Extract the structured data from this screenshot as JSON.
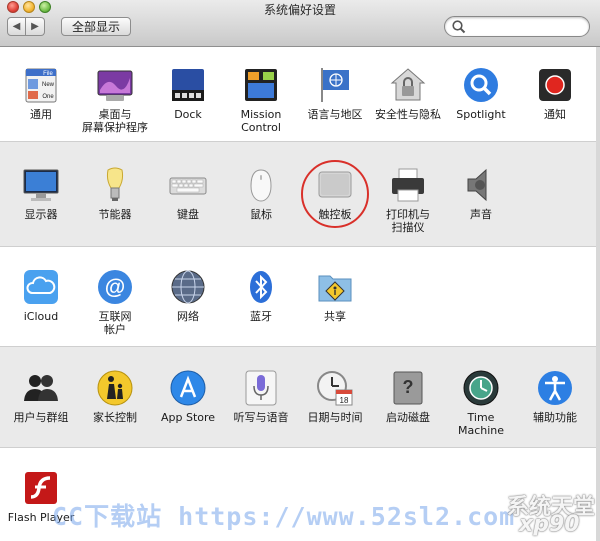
{
  "window": {
    "title": "系统偏好设置"
  },
  "toolbar": {
    "back": "◀",
    "forward": "▶",
    "show_all": "全部显示",
    "search_placeholder": "",
    "search_value": ""
  },
  "sections": [
    {
      "panes": [
        {
          "label": "通用",
          "icon": "general-icon"
        },
        {
          "label": "桌面与\n屏幕保护程序",
          "icon": "desktop-screensaver-icon"
        },
        {
          "label": "Dock",
          "icon": "dock-icon"
        },
        {
          "label": "Mission\nControl",
          "icon": "mission-control-icon"
        },
        {
          "label": "语言与地区",
          "icon": "language-region-icon"
        },
        {
          "label": "安全性与隐私",
          "icon": "security-privacy-icon"
        },
        {
          "label": "Spotlight",
          "icon": "spotlight-icon"
        },
        {
          "label": "通知",
          "icon": "notifications-icon"
        }
      ]
    },
    {
      "panes": [
        {
          "label": "显示器",
          "icon": "displays-icon"
        },
        {
          "label": "节能器",
          "icon": "energy-saver-icon"
        },
        {
          "label": "键盘",
          "icon": "keyboard-icon"
        },
        {
          "label": "鼠标",
          "icon": "mouse-icon"
        },
        {
          "label": "触控板",
          "icon": "trackpad-icon"
        },
        {
          "label": "打印机与\n扫描仪",
          "icon": "printers-scanners-icon"
        },
        {
          "label": "声音",
          "icon": "sound-icon"
        }
      ]
    },
    {
      "panes": [
        {
          "label": "iCloud",
          "icon": "icloud-icon"
        },
        {
          "label": "互联网\n帐户",
          "icon": "internet-accounts-icon"
        },
        {
          "label": "网络",
          "icon": "network-icon"
        },
        {
          "label": "蓝牙",
          "icon": "bluetooth-icon"
        },
        {
          "label": "共享",
          "icon": "sharing-icon"
        }
      ]
    },
    {
      "panes": [
        {
          "label": "用户与群组",
          "icon": "users-groups-icon"
        },
        {
          "label": "家长控制",
          "icon": "parental-controls-icon"
        },
        {
          "label": "App Store",
          "icon": "app-store-icon"
        },
        {
          "label": "听写与语音",
          "icon": "dictation-speech-icon"
        },
        {
          "label": "日期与时间",
          "icon": "date-time-icon"
        },
        {
          "label": "启动磁盘",
          "icon": "startup-disk-icon"
        },
        {
          "label": "Time Machine",
          "icon": "time-machine-icon"
        },
        {
          "label": "辅助功能",
          "icon": "accessibility-icon"
        }
      ]
    },
    {
      "panes": [
        {
          "label": "Flash Player",
          "icon": "flash-player-icon"
        }
      ]
    }
  ],
  "icon_texts": {
    "general_file": "File",
    "general_new": "New",
    "general_one": "One",
    "calendar_day": "18"
  },
  "watermark": {
    "url_text": "CC下载站 https://www.52sl2.com",
    "site_text": "系统天堂",
    "site_sub": "xp90"
  },
  "colors": {
    "highlight": "#d9302a",
    "section_alt": "#eaeaea"
  }
}
